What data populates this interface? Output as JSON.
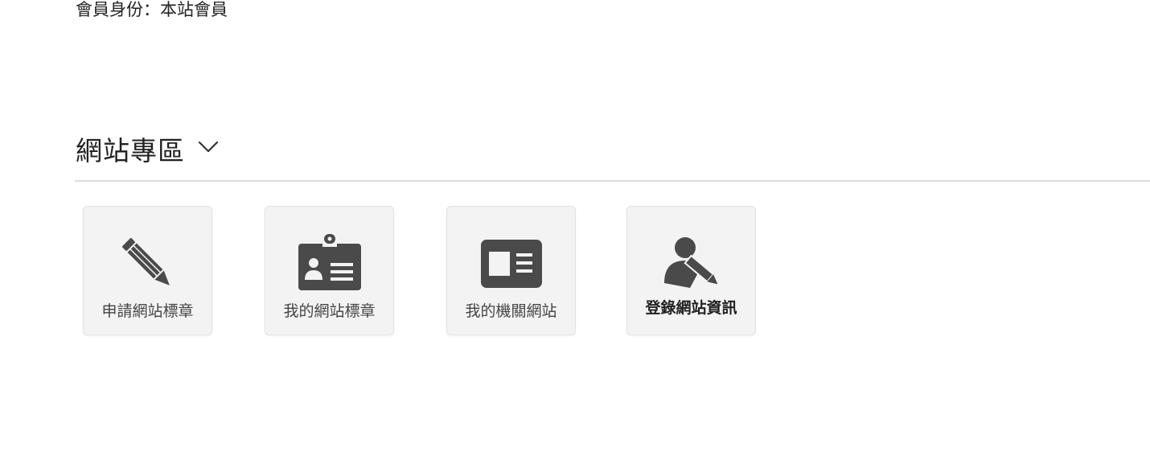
{
  "member": {
    "status_text": "會員身份：本站會員"
  },
  "section": {
    "title": "網站專區"
  },
  "tiles": [
    {
      "label": "申請網站標章",
      "icon": "pencil-icon"
    },
    {
      "label": "我的網站標章",
      "icon": "badge-id-icon"
    },
    {
      "label": "我的機關網站",
      "icon": "id-card-icon"
    },
    {
      "label": "登錄網站資訊",
      "icon": "user-edit-icon"
    }
  ],
  "colors": {
    "icon": "#4a4a4a",
    "tile_bg": "#f3f3f3",
    "divider": "#dddddd"
  }
}
